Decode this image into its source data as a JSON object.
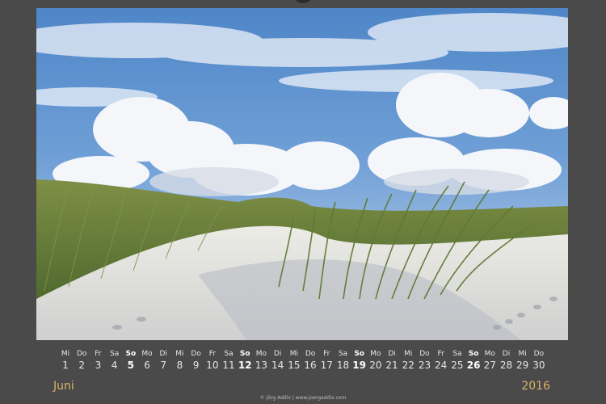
{
  "calendar": {
    "month": "Juni",
    "year": "2016",
    "days": [
      {
        "wd": "Mi",
        "d": "1",
        "sun": false
      },
      {
        "wd": "Do",
        "d": "2",
        "sun": false
      },
      {
        "wd": "Fr",
        "d": "3",
        "sun": false
      },
      {
        "wd": "Sa",
        "d": "4",
        "sun": false
      },
      {
        "wd": "So",
        "d": "5",
        "sun": true
      },
      {
        "wd": "Mo",
        "d": "6",
        "sun": false
      },
      {
        "wd": "Di",
        "d": "7",
        "sun": false
      },
      {
        "wd": "Mi",
        "d": "8",
        "sun": false
      },
      {
        "wd": "Do",
        "d": "9",
        "sun": false
      },
      {
        "wd": "Fr",
        "d": "10",
        "sun": false
      },
      {
        "wd": "Sa",
        "d": "11",
        "sun": false
      },
      {
        "wd": "So",
        "d": "12",
        "sun": true
      },
      {
        "wd": "Mo",
        "d": "13",
        "sun": false
      },
      {
        "wd": "Di",
        "d": "14",
        "sun": false
      },
      {
        "wd": "Mi",
        "d": "15",
        "sun": false
      },
      {
        "wd": "Do",
        "d": "16",
        "sun": false
      },
      {
        "wd": "Fr",
        "d": "17",
        "sun": false
      },
      {
        "wd": "Sa",
        "d": "18",
        "sun": false
      },
      {
        "wd": "So",
        "d": "19",
        "sun": true
      },
      {
        "wd": "Mo",
        "d": "20",
        "sun": false
      },
      {
        "wd": "Di",
        "d": "21",
        "sun": false
      },
      {
        "wd": "Mi",
        "d": "22",
        "sun": false
      },
      {
        "wd": "Do",
        "d": "23",
        "sun": false
      },
      {
        "wd": "Fr",
        "d": "24",
        "sun": false
      },
      {
        "wd": "Sa",
        "d": "25",
        "sun": false
      },
      {
        "wd": "So",
        "d": "26",
        "sun": true
      },
      {
        "wd": "Mo",
        "d": "27",
        "sun": false
      },
      {
        "wd": "Di",
        "d": "28",
        "sun": false
      },
      {
        "wd": "Mi",
        "d": "29",
        "sun": false
      },
      {
        "wd": "Do",
        "d": "30",
        "sun": false
      }
    ]
  },
  "credit": "© Jörg Addix | www.joergaddix.com",
  "colors": {
    "background": "#4a4a4a",
    "accent": "#d9b36a",
    "text": "#e6e6e6"
  }
}
